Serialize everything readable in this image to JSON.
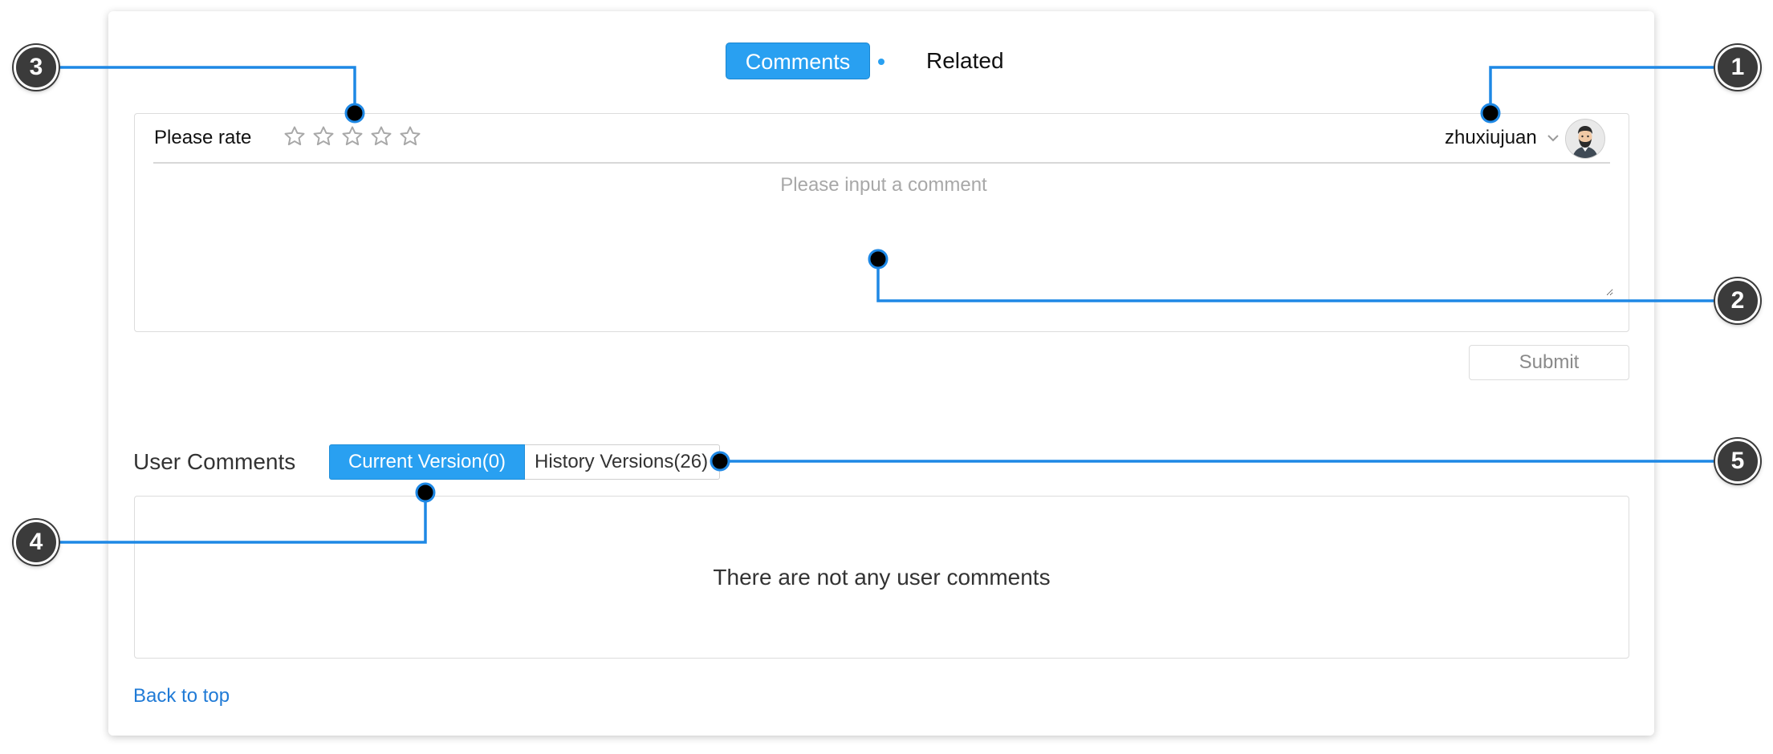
{
  "tabs": {
    "comments_label": "Comments",
    "related_label": "Related"
  },
  "comment_form": {
    "rate_label": "Please rate",
    "rating_max": 5,
    "rating_value": 0,
    "username": "zhuxiujuan",
    "placeholder": "Please input a comment",
    "submit_label": "Submit"
  },
  "user_comments": {
    "title": "User Comments",
    "current_version_label": "Current Version(0)",
    "history_versions_label": "History Versions(26)",
    "empty_message": "There are not any user comments"
  },
  "footer": {
    "back_to_top_label": "Back to top"
  },
  "callouts": [
    "1",
    "2",
    "3",
    "4",
    "5"
  ],
  "colors": {
    "accent": "#29a0f1",
    "link": "#1f7ad6",
    "callout_line": "#1e88e5",
    "badge": "#3b3b3b"
  },
  "icons": {
    "star": "star-outline-icon",
    "chevron": "chevron-down-icon",
    "avatar": "user-avatar"
  }
}
